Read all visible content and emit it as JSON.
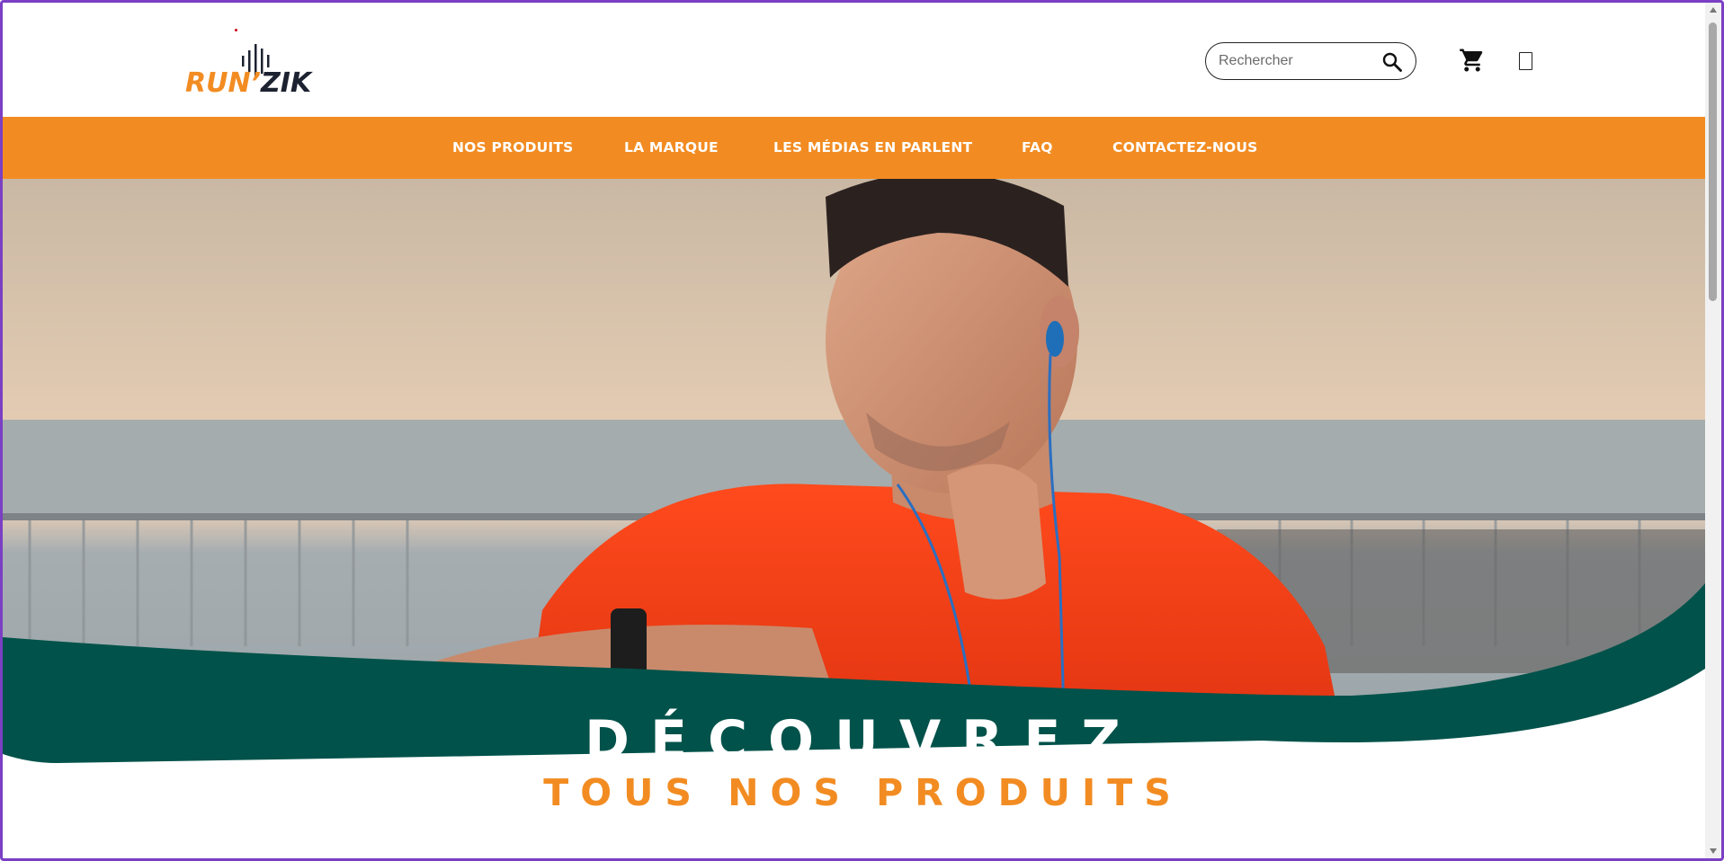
{
  "brand": {
    "name_part1": "RUN’",
    "name_part2": "ZIK"
  },
  "search": {
    "placeholder": "Rechercher"
  },
  "icons": {
    "search": "search-icon",
    "cart": "cart-icon",
    "account": "account-icon"
  },
  "nav": {
    "items": [
      {
        "label": "NOS PRODUITS"
      },
      {
        "label": "LA MARQUE"
      },
      {
        "label": "LES MÉDIAS EN PARLENT"
      },
      {
        "label": "FAQ"
      },
      {
        "label": "CONTACTEZ-NOUS"
      }
    ]
  },
  "hero": {
    "title_line1": "DÉCOUVREZ",
    "title_line2": "TOUS NOS PRODUITS"
  },
  "colors": {
    "accent": "#f28c22",
    "band": "#00524a",
    "dark": "#1d2230"
  }
}
